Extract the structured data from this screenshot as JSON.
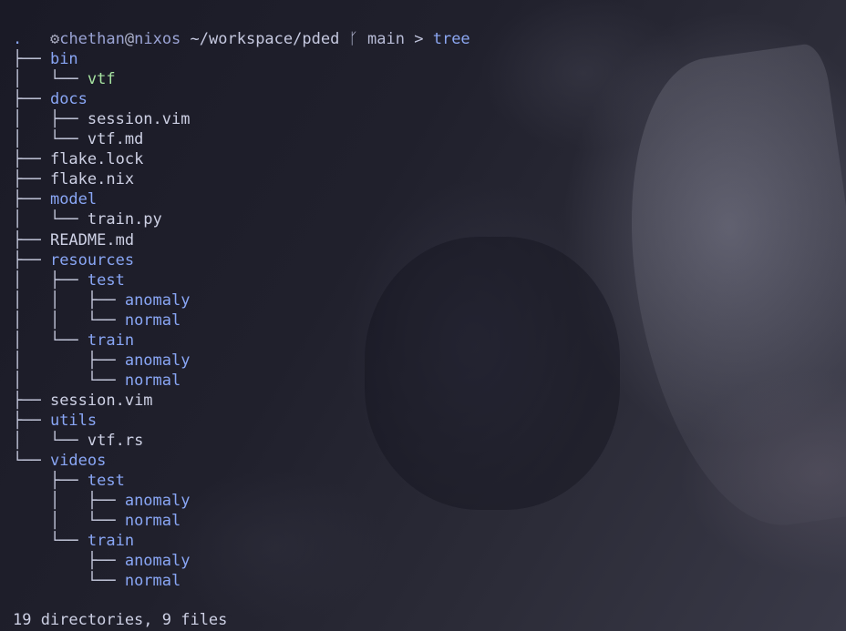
{
  "prompt": {
    "icon": "gear-icon",
    "user": "chethan",
    "at": "@",
    "host": "nixos",
    "cwd": "~/workspace/pded",
    "branch_icon": "git-branch-icon",
    "branch": "main",
    "arrow": ">",
    "command": "tree"
  },
  "tree": [
    {
      "prefix": "",
      "name": ".",
      "kind": "dot"
    },
    {
      "prefix": "├── ",
      "name": "bin",
      "kind": "dir"
    },
    {
      "prefix": "│   └── ",
      "name": "vtf",
      "kind": "exec"
    },
    {
      "prefix": "├── ",
      "name": "docs",
      "kind": "dir"
    },
    {
      "prefix": "│   ├── ",
      "name": "session.vim",
      "kind": "file"
    },
    {
      "prefix": "│   └── ",
      "name": "vtf.md",
      "kind": "file"
    },
    {
      "prefix": "├── ",
      "name": "flake.lock",
      "kind": "file"
    },
    {
      "prefix": "├── ",
      "name": "flake.nix",
      "kind": "file"
    },
    {
      "prefix": "├── ",
      "name": "model",
      "kind": "dir"
    },
    {
      "prefix": "│   └── ",
      "name": "train.py",
      "kind": "file"
    },
    {
      "prefix": "├── ",
      "name": "README.md",
      "kind": "file"
    },
    {
      "prefix": "├── ",
      "name": "resources",
      "kind": "dir"
    },
    {
      "prefix": "│   ├── ",
      "name": "test",
      "kind": "dir"
    },
    {
      "prefix": "│   │   ├── ",
      "name": "anomaly",
      "kind": "dir"
    },
    {
      "prefix": "│   │   └── ",
      "name": "normal",
      "kind": "dir"
    },
    {
      "prefix": "│   └── ",
      "name": "train",
      "kind": "dir"
    },
    {
      "prefix": "│       ├── ",
      "name": "anomaly",
      "kind": "dir"
    },
    {
      "prefix": "│       └── ",
      "name": "normal",
      "kind": "dir"
    },
    {
      "prefix": "├── ",
      "name": "session.vim",
      "kind": "file"
    },
    {
      "prefix": "├── ",
      "name": "utils",
      "kind": "dir"
    },
    {
      "prefix": "│   └── ",
      "name": "vtf.rs",
      "kind": "file"
    },
    {
      "prefix": "└── ",
      "name": "videos",
      "kind": "dir"
    },
    {
      "prefix": "    ├── ",
      "name": "test",
      "kind": "dir"
    },
    {
      "prefix": "    │   ├── ",
      "name": "anomaly",
      "kind": "dir"
    },
    {
      "prefix": "    │   └── ",
      "name": "normal",
      "kind": "dir"
    },
    {
      "prefix": "    └── ",
      "name": "train",
      "kind": "dir"
    },
    {
      "prefix": "        ├── ",
      "name": "anomaly",
      "kind": "dir"
    },
    {
      "prefix": "        └── ",
      "name": "normal",
      "kind": "dir"
    }
  ],
  "summary": "19 directories, 9 files",
  "colors": {
    "directory": "#89a6f5",
    "executable": "#a6e3a1",
    "file": "#cdd0e4",
    "background": "#15151f"
  }
}
